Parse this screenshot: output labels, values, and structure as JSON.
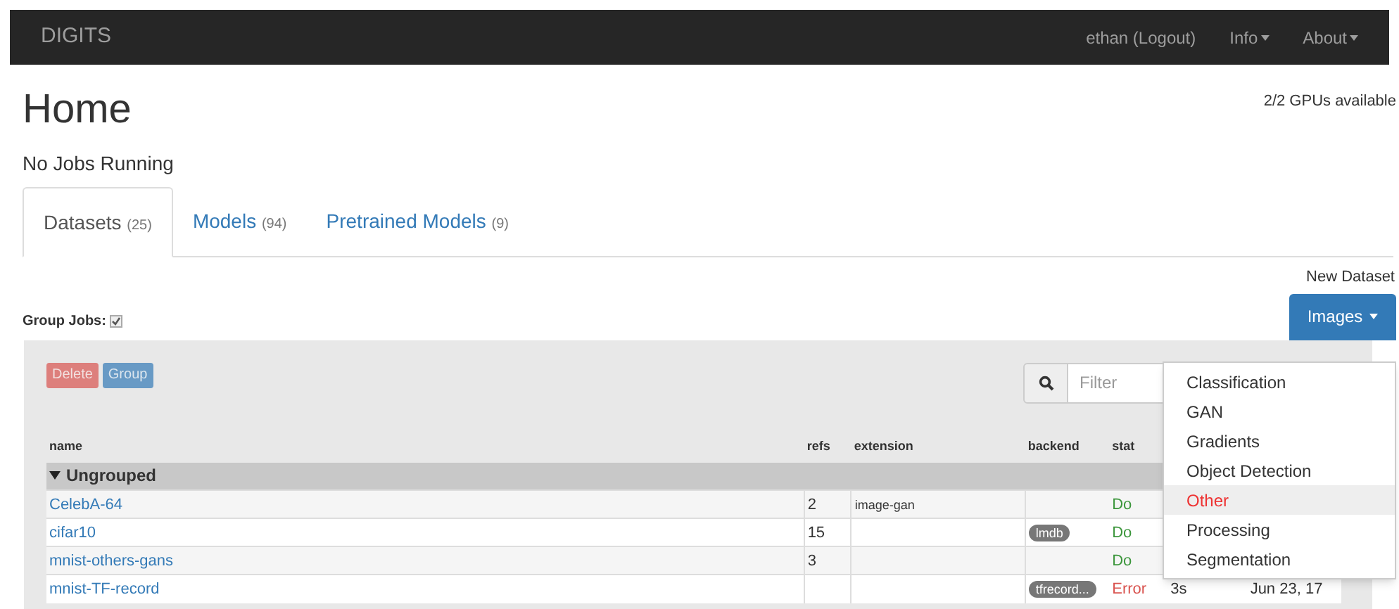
{
  "navbar": {
    "brand": "DIGITS",
    "links": [
      {
        "label": "ethan (Logout)",
        "caret": false
      },
      {
        "label": "Info",
        "caret": true
      },
      {
        "label": "About",
        "caret": true
      }
    ]
  },
  "page": {
    "title": "Home",
    "gpus": "2/2 GPUs available",
    "running": "No Jobs Running"
  },
  "tabs": [
    {
      "label": "Datasets",
      "count": "(25)",
      "selected": true
    },
    {
      "label": "Models",
      "count": "(94)",
      "selected": false
    },
    {
      "label": "Pretrained Models",
      "count": "(9)",
      "selected": false
    }
  ],
  "group_jobs": {
    "label": "Group Jobs:",
    "checked": true
  },
  "new_dataset": {
    "label": "New Dataset",
    "button": "Images",
    "menu": [
      {
        "label": "Classification",
        "selected": false
      },
      {
        "label": "GAN",
        "selected": false
      },
      {
        "label": "Gradients",
        "selected": false
      },
      {
        "label": "Object Detection",
        "selected": false
      },
      {
        "label": "Other",
        "selected": true
      },
      {
        "label": "Processing",
        "selected": false
      },
      {
        "label": "Segmentation",
        "selected": false
      }
    ]
  },
  "actions": [
    "Delete",
    "Group"
  ],
  "filter": {
    "placeholder": "Filter"
  },
  "table": {
    "columns": [
      "name",
      "refs",
      "extension",
      "backend",
      "stat"
    ],
    "group": {
      "label": "Ungrouped",
      "expanded": true
    },
    "rows": [
      {
        "name": "CelebA-64",
        "refs": "2",
        "extension": "image-gan",
        "backend": "",
        "status": "Do",
        "color": "#3c963c"
      },
      {
        "name": "cifar10",
        "refs": "15",
        "extension": "",
        "backend": "lmdb",
        "status": "Do",
        "color": "#3c963c"
      },
      {
        "name": "mnist-others-gans",
        "refs": "3",
        "extension": "",
        "backend": "",
        "status": "Do",
        "color": "#3c963c"
      },
      {
        "name": "mnist-TF-record",
        "refs": "",
        "extension": "",
        "backend": "tfrecord...",
        "status": "Error",
        "color": "#d9534f",
        "column_6": "3s",
        "column_7": "Jun 23, 17"
      }
    ]
  }
}
